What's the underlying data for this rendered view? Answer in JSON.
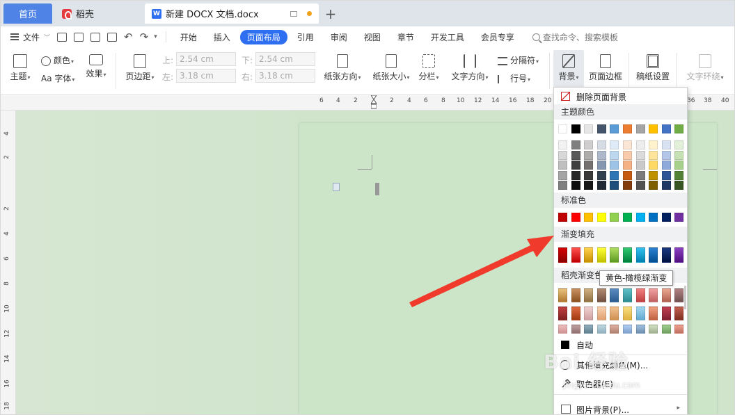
{
  "titlebar": {
    "tabs": [
      {
        "label": "首页"
      },
      {
        "label": "稻壳"
      },
      {
        "label": "新建 DOCX 文档.docx"
      }
    ],
    "add_tab": "+"
  },
  "menu": {
    "file_label": "文件",
    "tabs": [
      "开始",
      "插入",
      "页面布局",
      "引用",
      "审阅",
      "视图",
      "章节",
      "开发工具",
      "会员专享"
    ],
    "active_tab": "页面布局",
    "search_placeholder": "查找命令、搜索模板"
  },
  "ribbon": {
    "theme": "主题",
    "color": "颜色",
    "font": "Aa 字体",
    "effect": "效果",
    "margins": "页边距",
    "top_label": "上:",
    "top_value": "2.54 cm",
    "bottom_label": "下:",
    "bottom_value": "2.54 cm",
    "left_label": "左:",
    "left_value": "3.18 cm",
    "right_label": "右:",
    "right_value": "3.18 cm",
    "orientation": "纸张方向",
    "size": "纸张大小",
    "columns": "分栏",
    "text_direction": "文字方向",
    "breaks": "分隔符",
    "line_numbers": "行号",
    "background": "背景",
    "page_border": "页面边框",
    "manuscript": "稿纸设置",
    "text_wrap": "文字环绕"
  },
  "ruler_numbers": [
    "6",
    "4",
    "2",
    "2",
    "4",
    "6",
    "8",
    "10",
    "12",
    "14",
    "16",
    "18",
    "20",
    "36",
    "38",
    "40"
  ],
  "vruler_numbers": [
    "4",
    "2",
    "2",
    "4",
    "6",
    "8",
    "10",
    "12",
    "14",
    "16",
    "18"
  ],
  "dropdown": {
    "remove_bg": "删除页面背景",
    "theme_colors_title": "主题颜色",
    "theme_top_row": [
      "#ffffff",
      "#000000",
      "#e7e6e6",
      "#44546a",
      "#5b9bd5",
      "#ed7d31",
      "#a5a5a5",
      "#ffc000",
      "#4472c4",
      "#70ad47"
    ],
    "theme_shades": [
      [
        "#f2f2f2",
        "#7f7f7f",
        "#d0cece",
        "#d6dce4",
        "#deebf6",
        "#fbe5d5",
        "#ededed",
        "#fff2cc",
        "#d9e2f3",
        "#e2efd9"
      ],
      [
        "#d8d8d8",
        "#595959",
        "#aeabab",
        "#adb9ca",
        "#bdd7ee",
        "#f7cbac",
        "#dbdbdb",
        "#fee599",
        "#b4c6e7",
        "#c5e0b3"
      ],
      [
        "#bfbfbf",
        "#3f3f3f",
        "#757070",
        "#8496b0",
        "#9dc3e6",
        "#f4b183",
        "#c9c9c9",
        "#ffd965",
        "#8eaadb",
        "#a8d08d"
      ],
      [
        "#a5a5a5",
        "#262626",
        "#3a3838",
        "#323f4f",
        "#2e75b5",
        "#c55a11",
        "#7b7b7b",
        "#bf9000",
        "#2f5496",
        "#538135"
      ],
      [
        "#7f7f7f",
        "#0c0c0c",
        "#171616",
        "#222a35",
        "#1e4e79",
        "#833c0b",
        "#525252",
        "#7f6000",
        "#1f3864",
        "#375623"
      ]
    ],
    "standard_colors_title": "标准色",
    "standard_colors": [
      "#c00000",
      "#ff0000",
      "#ffc000",
      "#ffff00",
      "#92d050",
      "#00b050",
      "#00b0f0",
      "#0070c0",
      "#002060",
      "#7030a0"
    ],
    "gradient_title": "渐变填充",
    "gradient_fills": [
      [
        "#d40000",
        "#8a0000"
      ],
      [
        "#ff5050",
        "#c00000"
      ],
      [
        "#ffd24d",
        "#c89000"
      ],
      [
        "#ffff33",
        "#c0c000"
      ],
      [
        "#b0dd60",
        "#5a9a20"
      ],
      [
        "#30c870",
        "#00803c"
      ],
      [
        "#30c0f0",
        "#0080b0"
      ],
      [
        "#2a80d0",
        "#004e90"
      ],
      [
        "#1a3a80",
        "#001040"
      ],
      [
        "#8a40c0",
        "#501080"
      ]
    ],
    "daoke_gradient_title": "稻壳渐变色",
    "daoke_rows": [
      [
        [
          "#e8c07a",
          "#b07830"
        ],
        [
          "#c89060",
          "#8a5020"
        ],
        [
          "#d0b080",
          "#907040"
        ],
        [
          "#b08a70",
          "#705040"
        ],
        [
          "#5a8ac0",
          "#2a5a90"
        ],
        [
          "#60c0c8",
          "#2a8a90"
        ],
        [
          "#f08080",
          "#c04040"
        ],
        [
          "#f0a0a0",
          "#c06060"
        ],
        [
          "#e8a890",
          "#b06050"
        ],
        [
          "#b08080",
          "#705050"
        ]
      ],
      [
        [
          "#c04040",
          "#802020"
        ],
        [
          "#e06a40",
          "#a03a10"
        ],
        [
          "#f0d0d0",
          "#d0a0a0"
        ],
        [
          "#f8d0b0",
          "#e0a070"
        ],
        [
          "#f0c090",
          "#d09050"
        ],
        [
          "#f8e080",
          "#e0b040"
        ],
        [
          "#a0d8f0",
          "#60a8d0"
        ],
        [
          "#f0a080",
          "#c06040"
        ],
        [
          "#c04050",
          "#802030"
        ],
        [
          "#c06050",
          "#803020"
        ]
      ],
      [
        [
          "#f0c0c0",
          "#d09090"
        ],
        [
          "#c0a0a0",
          "#907070"
        ],
        [
          "#90b0c0",
          "#608090"
        ],
        [
          "#c0d8e0",
          "#90b0c0"
        ],
        [
          "#e0b0a0",
          "#b08070"
        ],
        [
          "#b0d0f0",
          "#80a0d0"
        ],
        [
          "#a0c0e0",
          "#7090b0"
        ],
        [
          "#d0e0c0",
          "#a0b090"
        ],
        [
          "#a0d090",
          "#70a060"
        ],
        [
          "#f0a090",
          "#c07060"
        ]
      ]
    ],
    "auto_label": "自动",
    "more_fill_colors": "其他填充颜色(M)...",
    "eyedropper": "取色器(E)",
    "picture_bg": "图片背景(P)..."
  },
  "tooltip": "黄色-橄榄绿渐变",
  "watermark": {
    "logo": "Bai 经验",
    "url": "jingyan.baidu.com"
  }
}
